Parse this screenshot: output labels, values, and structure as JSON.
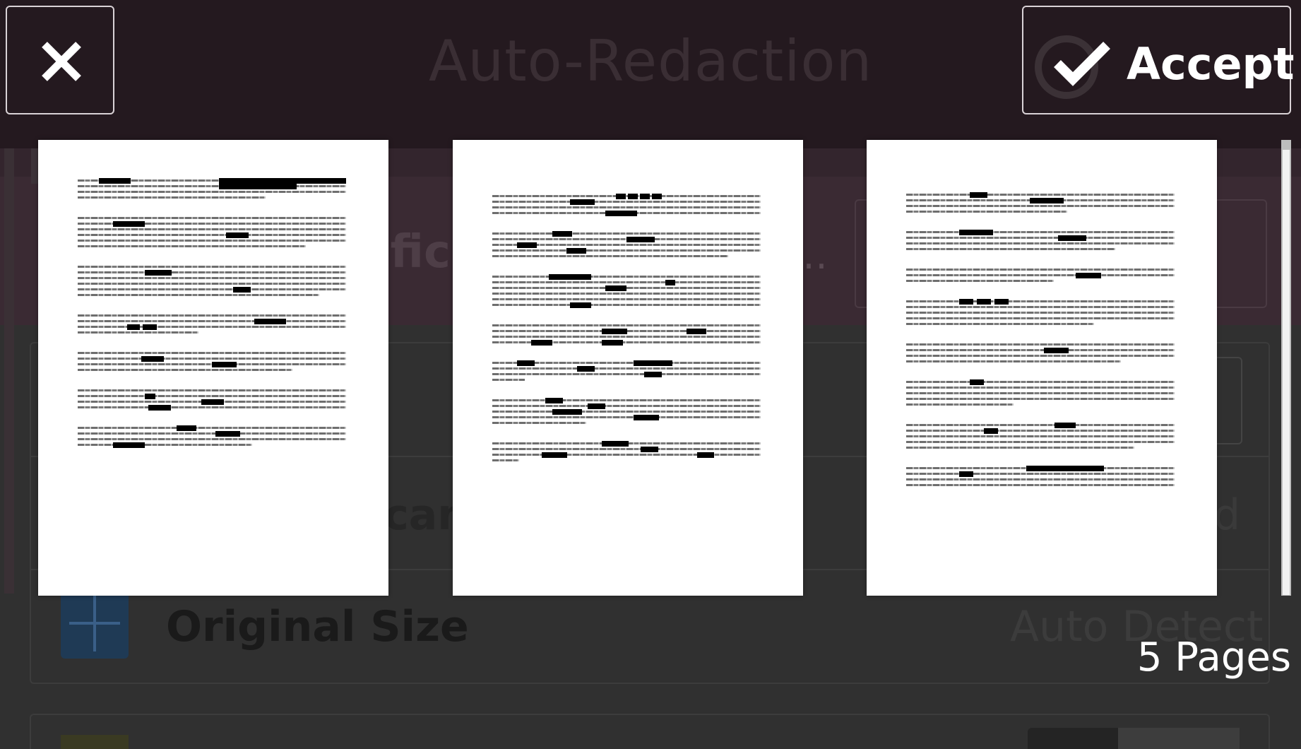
{
  "header": {
    "title": "Auto-Redaction",
    "accept_label": "Accept"
  },
  "icons": {
    "close": "close-icon",
    "accept": "checkmark-icon"
  },
  "preview": {
    "page_count_label": "5 Pages",
    "visible_pages": 3
  },
  "background_screen": {
    "row_label": "Original Size",
    "row_value": "Auto Detect"
  },
  "colors": {
    "header_bg": "#24191f",
    "button_border": "#d9d2d6",
    "redaction": "#000000"
  }
}
